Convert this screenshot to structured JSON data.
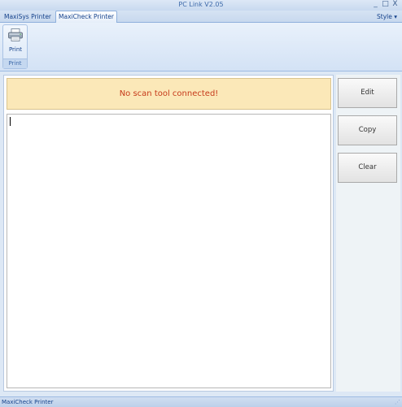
{
  "window": {
    "title": "PC Link V2.05",
    "controls": {
      "minimize": "_",
      "maximize": "□",
      "close": "X"
    }
  },
  "tabs": [
    {
      "label": "MaxiSys Printer",
      "active": false
    },
    {
      "label": "MaxiCheck Printer",
      "active": true
    }
  ],
  "style_menu": {
    "label": "Style",
    "arrow": "▾"
  },
  "ribbon": {
    "print_button": {
      "label": "Print",
      "icon": "printer-icon"
    },
    "group_label": "Print"
  },
  "main": {
    "status_message": "No scan tool connected!",
    "status_color": "#c63a1a",
    "output_text": ""
  },
  "side_buttons": {
    "edit": "Edit",
    "copy": "Copy",
    "clear": "Clear"
  },
  "statusbar": {
    "text": "MaxiCheck Printer",
    "grip": "⋰"
  },
  "colors": {
    "accent": "#15428b",
    "banner_bg": "#fbe8b8"
  }
}
